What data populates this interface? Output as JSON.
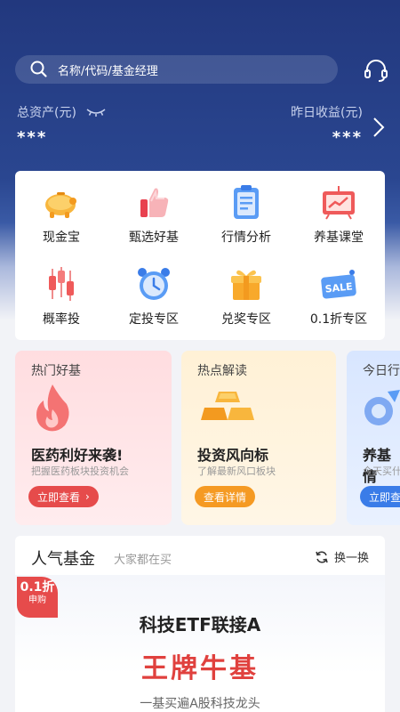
{
  "colors": {
    "header_bg": "#22387e",
    "accent_red": "#e0413e",
    "button_orange": "#f59a23",
    "button_blue": "#3a7ce8"
  },
  "search": {
    "placeholder": "名称/代码/基金经理"
  },
  "assets": {
    "total_label": "总资产(元)",
    "total_value": "***",
    "yesterday_label": "昨日收益(元)",
    "yesterday_value": "***"
  },
  "grid": [
    {
      "label": "现金宝",
      "icon": "piggy-bank-icon"
    },
    {
      "label": "甄选好基",
      "icon": "thumbs-up-icon"
    },
    {
      "label": "行情分析",
      "icon": "clipboard-icon"
    },
    {
      "label": "养基课堂",
      "icon": "chalkboard-icon"
    },
    {
      "label": "概率投",
      "icon": "candlestick-icon"
    },
    {
      "label": "定投专区",
      "icon": "alarm-clock-icon"
    },
    {
      "label": "兑奖专区",
      "icon": "gift-icon"
    },
    {
      "label": "0.1折专区",
      "icon": "sale-tag-icon"
    }
  ],
  "promos": [
    {
      "tag": "热门好基",
      "title": "医药利好来袭!",
      "subtitle": "把握医药板块投资机会",
      "button": "立即查看",
      "icon": "flame-icon"
    },
    {
      "tag": "热点解读",
      "title": "投资风向标",
      "subtitle": "了解最新风口板块",
      "button": "查看详情",
      "icon": "gold-bars-icon"
    },
    {
      "tag": "今日行",
      "title": "养基情",
      "subtitle": "今天买什",
      "button": "立即查",
      "icon": "paper-plane-icon"
    }
  ],
  "popular": {
    "title": "人气基金",
    "subtitle": "大家都在买",
    "refresh": "换一换",
    "badge_value": "0.1折",
    "badge_sub": "申购",
    "fund_name": "科技ETF联接A",
    "fund_tag": "王牌牛基",
    "fund_desc": "一基买遍A股科技龙头"
  }
}
